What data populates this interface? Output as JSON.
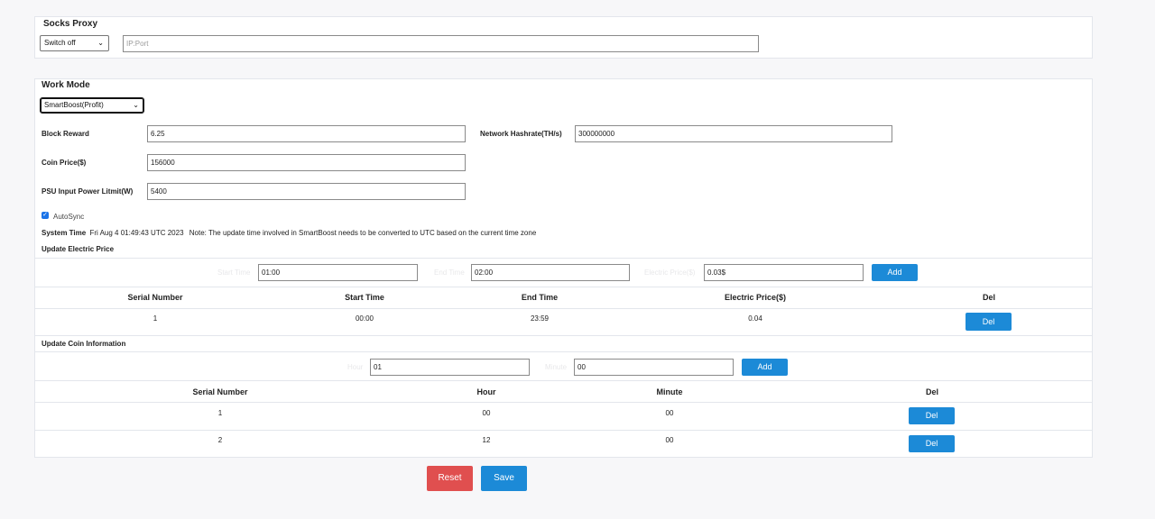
{
  "socks_proxy": {
    "title": "Socks Proxy",
    "switch_value": "Switch off",
    "ip_port_placeholder": "IP:Port"
  },
  "work_mode": {
    "title": "Work Mode",
    "mode_value": "SmartBoost(Profit)",
    "block_reward_label": "Block Reward",
    "block_reward_value": "6.25",
    "network_hashrate_label": "Network Hashrate(TH/s)",
    "network_hashrate_value": "300000000",
    "coin_price_label": "Coin Price($)",
    "coin_price_value": "156000",
    "psu_label": "PSU Input Power Litmit(W)",
    "psu_value": "5400",
    "autosync_label": "AutoSync",
    "autosync_checked": true,
    "system_time_label": "System Time",
    "system_time_value": "Fri Aug 4 01:49:43 UTC 2023",
    "system_time_note": "Note: The update time involved in SmartBoost needs to be converted to UTC based on the current time zone"
  },
  "electric_price": {
    "title": "Update Electric Price",
    "start_label": "Start Time",
    "start_value": "01:00",
    "end_label": "End Time",
    "end_value": "02:00",
    "price_label": "Electric Price($)",
    "price_value": "0.03$",
    "add_label": "Add",
    "headers": [
      "Serial Number",
      "Start Time",
      "End Time",
      "Electric Price($)",
      "Del"
    ],
    "rows": [
      {
        "serial": "1",
        "start": "00:00",
        "end": "23:59",
        "price": "0.04",
        "del": "Del"
      }
    ]
  },
  "coin_info": {
    "title": "Update Coin Information",
    "hour_label": "Hour",
    "hour_value": "01",
    "minute_label": "Minute",
    "minute_value": "00",
    "add_label": "Add",
    "headers": [
      "Serial Number",
      "Hour",
      "Minute",
      "Del"
    ],
    "rows": [
      {
        "serial": "1",
        "hour": "00",
        "minute": "00",
        "del": "Del"
      },
      {
        "serial": "2",
        "hour": "12",
        "minute": "00",
        "del": "Del"
      }
    ]
  },
  "actions": {
    "reset_label": "Reset",
    "save_label": "Save"
  },
  "colors": {
    "primary": "#1c8ad7",
    "danger": "#e04f4f",
    "checkbox": "#1a73e8"
  }
}
